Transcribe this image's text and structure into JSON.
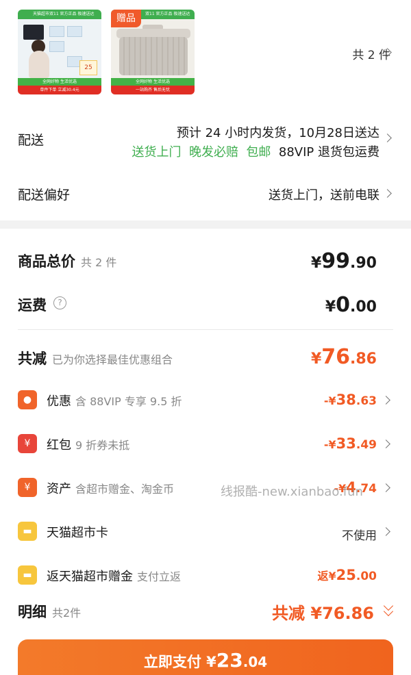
{
  "products": {
    "item1": {
      "top_banner": "天猫超市双11 官方正品 极速送达",
      "green_band": "全网好物 生活优选",
      "red_band": "单件下单 立减30.4元",
      "price_bubble": "25"
    },
    "item2": {
      "gift_tag": "赠品",
      "top_banner": "双11 官方正品 极速送达",
      "green_band": "全网好物 生活优选",
      "red_band": "一站购齐 售后无忧"
    },
    "count_text": "共 2 件"
  },
  "delivery": {
    "label": "配送",
    "eta": "预计 24 小时内发货，10月28日送达",
    "services": [
      "送货上门",
      "晚发必赔",
      "包邮"
    ],
    "vip_service": "88VIP 退货包运费"
  },
  "delivery_pref": {
    "label": "配送偏好",
    "value": "送货上门，送前电联"
  },
  "summary": {
    "goods_total": {
      "label": "商品总价",
      "sub": "共 2 件",
      "yen": "¥",
      "int": "99",
      "dec": ".90"
    },
    "shipping": {
      "label": "运费",
      "help": "?",
      "yen": "¥",
      "int": "0",
      "dec": ".00"
    },
    "total_discount": {
      "label": "共减",
      "sub": "已为你选择最佳优惠组合",
      "yen": "¥",
      "int": "76",
      "dec": ".86"
    }
  },
  "discounts": [
    {
      "icon": "tag-icon",
      "icon_glyph": "●",
      "color": "#f0642a",
      "label": "优惠",
      "sub": "含 88VIP 专享 9.5 折",
      "pre": "-¥",
      "int": "38",
      "dec": ".63"
    },
    {
      "icon": "red-packet-icon",
      "icon_glyph": "¥",
      "color": "#e8453a",
      "label": "红包",
      "sub": "9 折券未抵",
      "pre": "-¥",
      "int": "33",
      "dec": ".49"
    },
    {
      "icon": "asset-icon",
      "icon_glyph": "¥",
      "color": "#f0642a",
      "label": "资产",
      "sub": "含超市赠金、淘金币",
      "pre": "-¥",
      "int": "4",
      "dec": ".74"
    },
    {
      "icon": "card-icon",
      "icon_glyph": "▬",
      "color": "#f7c63d",
      "label": "天猫超市卡",
      "value": "不使用"
    },
    {
      "icon": "card-icon",
      "icon_glyph": "▬",
      "color": "#f7c63d",
      "label": "返天猫超市赠金",
      "sub": "支付立返",
      "pre": "返¥",
      "int": "25",
      "dec": ".00"
    }
  ],
  "watermark": "线报酷-new.xianbao.fun",
  "detail": {
    "label": "明细",
    "sub": "共2件",
    "total": "共减 ¥76.86"
  },
  "pay_button": {
    "label": "立即支付 ¥",
    "int": "23",
    "dec": ".04"
  }
}
